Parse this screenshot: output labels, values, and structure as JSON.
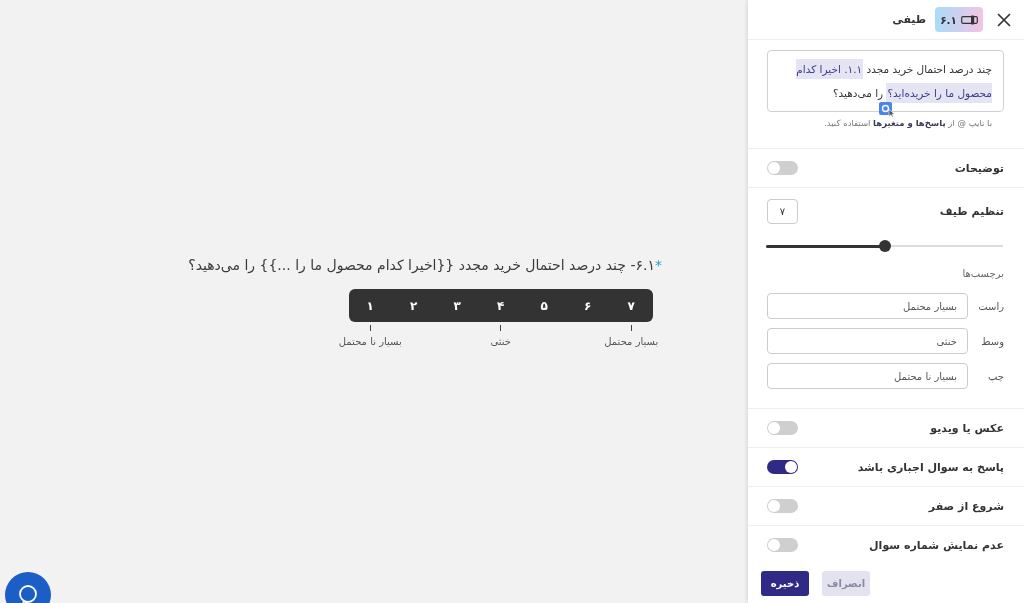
{
  "preview": {
    "question": {
      "mark": "*",
      "text": "۶.۱- چند درصد احتمال خرید مجدد {{اخیرا کدام محصول ما را ...}} را می‌دهید؟"
    },
    "scale": {
      "options": [
        "۷",
        "۶",
        "۵",
        "۴",
        "۳",
        "۲",
        "۱"
      ],
      "labels": [
        "بسیار محتمل",
        "خنثی",
        "بسیار نا محتمل"
      ]
    }
  },
  "panel": {
    "title": "طیفی",
    "badge": "۶.۱",
    "question_field": {
      "segments": [
        {
          "kind": "text",
          "text": "چند درصد احتمال خرید مجدد"
        },
        {
          "kind": "variable",
          "text": "۱.۱. اخیرا کدام محصول ما را خریده‌اید؟"
        },
        {
          "kind": "text",
          "text": "را می‌دهید؟"
        }
      ],
      "hint": "با تایپ @ از **پاسخ‌ها و متغیرها** استفاده کنید."
    },
    "settings": [
      {
        "kind": "toggle",
        "label": "توضیحات",
        "on": false
      },
      {
        "kind": "scale",
        "label": "تنظیم طیف",
        "value": "۷",
        "level": 0.5,
        "labels_heading": "برچسب‌ها",
        "labels": [
          {
            "name": "راست",
            "value": "بسیار محتمل"
          },
          {
            "name": "وسط",
            "value": "خنثی"
          },
          {
            "name": "چپ",
            "value": "بسیار نا محتمل"
          }
        ]
      },
      {
        "kind": "toggle",
        "label": "عکس یا ویدیو",
        "on": false
      },
      {
        "kind": "toggle",
        "label": "پاسخ به سوال اجباری باشد",
        "on": true
      },
      {
        "kind": "toggle",
        "label": "شروع از صفر",
        "on": false
      },
      {
        "kind": "toggle",
        "label": "عدم نمایش شماره سوال",
        "on": false
      }
    ],
    "buttons": [
      {
        "kind": "secondary",
        "label": "انصراف"
      },
      {
        "kind": "primary",
        "label": "ذخیره"
      }
    ]
  }
}
